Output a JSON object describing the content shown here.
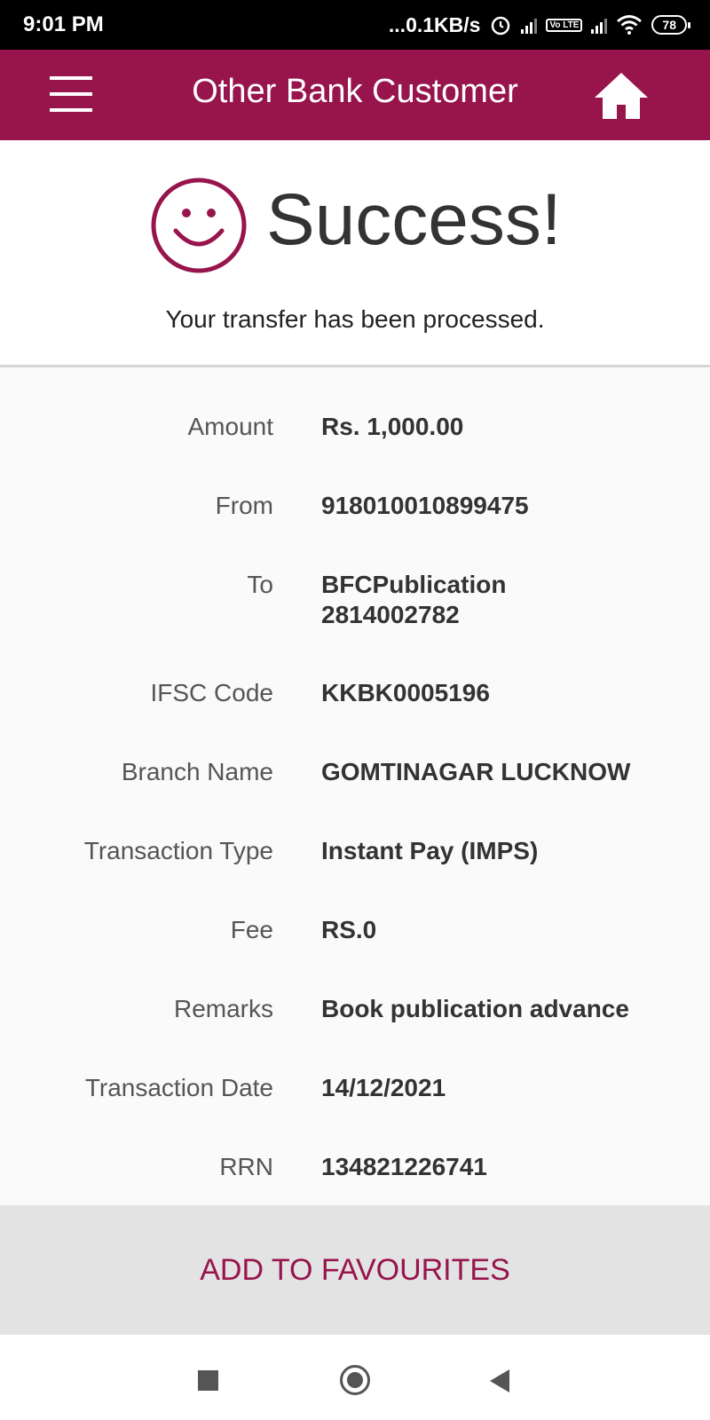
{
  "status_bar": {
    "time": "9:01 PM",
    "network_speed": "...0.1KB/s",
    "volte": "Vo LTE",
    "battery": "78",
    "icons": [
      "alarm-icon",
      "signal-icon",
      "volte-icon",
      "signal-icon",
      "wifi-icon",
      "battery-icon"
    ]
  },
  "app_bar": {
    "title": "Other Bank Customer",
    "icons": [
      "menu-icon",
      "home-icon"
    ]
  },
  "colors": {
    "brand": "#97144d",
    "fav_background": "#e3e3e3"
  },
  "success": {
    "title": "Success!",
    "message": "Your transfer has been processed.",
    "icon": "smiley-icon"
  },
  "details": [
    {
      "label": "Amount",
      "value": "Rs. 1,000.00"
    },
    {
      "label": "From",
      "value": "918010010899475"
    },
    {
      "label": "To",
      "value": "BFCPublication",
      "value2": "2814002782"
    },
    {
      "label": "IFSC Code",
      "value": "KKBK0005196"
    },
    {
      "label": "Branch Name",
      "value": "GOMTINAGAR LUCKNOW"
    },
    {
      "label": "Transaction Type",
      "value": "Instant Pay (IMPS)"
    },
    {
      "label": "Fee",
      "value": "RS.0"
    },
    {
      "label": "Remarks",
      "value": "Book publication advance"
    },
    {
      "label": "Transaction Date",
      "value": "14/12/2021"
    },
    {
      "label": "RRN",
      "value": "134821226741"
    }
  ],
  "actions": {
    "add_to_favourites": "ADD TO FAVOURITES"
  }
}
